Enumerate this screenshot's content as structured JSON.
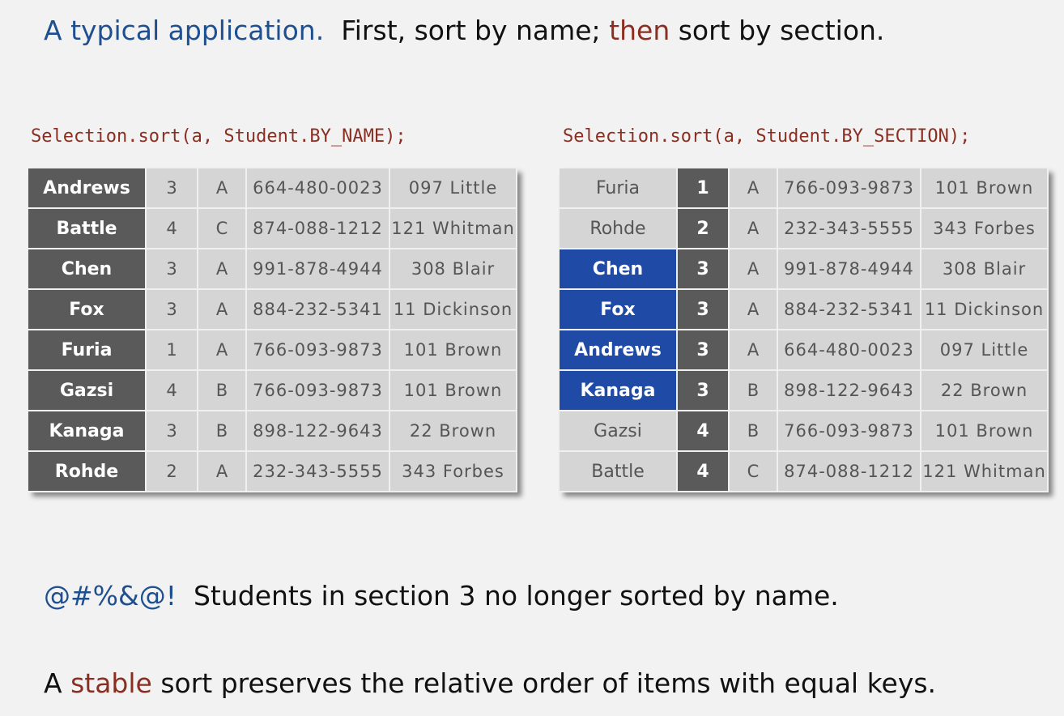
{
  "heading": {
    "lead": "A typical application.",
    "part1": "First, sort by name; ",
    "then": "then",
    "part2": " sort by section."
  },
  "left": {
    "call": "Selection.sort(a, Student.BY_NAME);",
    "rows": [
      [
        "Andrews",
        "3",
        "A",
        "664-480-0023",
        "097 Little"
      ],
      [
        "Battle",
        "4",
        "C",
        "874-088-1212",
        "121 Whitman"
      ],
      [
        "Chen",
        "3",
        "A",
        "991-878-4944",
        "308 Blair"
      ],
      [
        "Fox",
        "3",
        "A",
        "884-232-5341",
        "11 Dickinson"
      ],
      [
        "Furia",
        "1",
        "A",
        "766-093-9873",
        "101 Brown"
      ],
      [
        "Gazsi",
        "4",
        "B",
        "766-093-9873",
        "101 Brown"
      ],
      [
        "Kanaga",
        "3",
        "B",
        "898-122-9643",
        "22 Brown"
      ],
      [
        "Rohde",
        "2",
        "A",
        "232-343-5555",
        "343 Forbes"
      ]
    ]
  },
  "right": {
    "call": "Selection.sort(a, Student.BY_SECTION);",
    "rows": [
      [
        "Furia",
        "1",
        "A",
        "766-093-9873",
        "101 Brown"
      ],
      [
        "Rohde",
        "2",
        "A",
        "232-343-5555",
        "343 Forbes"
      ],
      [
        "Chen",
        "3",
        "A",
        "991-878-4944",
        "308 Blair"
      ],
      [
        "Fox",
        "3",
        "A",
        "884-232-5341",
        "11 Dickinson"
      ],
      [
        "Andrews",
        "3",
        "A",
        "664-480-0023",
        "097 Little"
      ],
      [
        "Kanaga",
        "3",
        "B",
        "898-122-9643",
        "22 Brown"
      ],
      [
        "Gazsi",
        "4",
        "B",
        "766-093-9873",
        "101 Brown"
      ],
      [
        "Battle",
        "4",
        "C",
        "874-088-1212",
        "121 Whitman"
      ]
    ],
    "highlighted_rows": [
      2,
      3,
      4,
      5
    ]
  },
  "note": {
    "symbols": "@#%&@!",
    "text": "Students in section 3 no longer sorted by name."
  },
  "definition": {
    "a": "A ",
    "stable": "stable",
    "rest": " sort preserves the relative order of items with equal keys."
  },
  "colors": {
    "key_column": "#5a5a5a",
    "cell": "#d5d5d5",
    "highlight": "#1f4aa6",
    "accent_blue": "#1f4f8f",
    "accent_red": "#8a2e22"
  }
}
